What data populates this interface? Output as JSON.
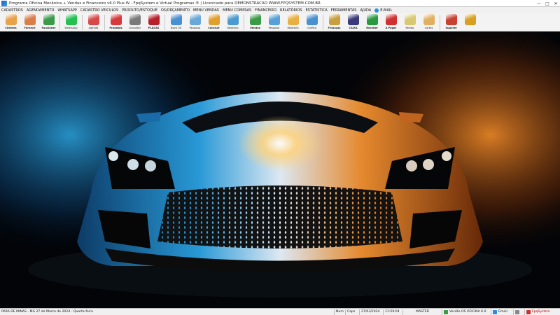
{
  "window": {
    "title": "Programa Oficina Mecânica + Vendas e Financeiro v6.0 Plus W - FpqSystem e Virtual Programas ® | Licenciado para DEMONSTRACAO WWW.FPQSYSTEM.COM.BR",
    "controls": {
      "minimize": "—",
      "maximize": "□",
      "close": "✕"
    }
  },
  "menu": [
    "CADASTROS",
    "AGENDAMENTO",
    "WHATSAPP",
    "CADASTRO VEICULOS",
    "PRODUTO/ESTOQUE",
    "OS/ORÇAMENTO",
    "MENU VENDAS",
    "MENU COMPRAS",
    "FINANCEIRO",
    "RELATÓRIOS",
    "ESTATISTICA",
    "FERRAMENTAS",
    "AJUDA",
    "E-MAIL"
  ],
  "toolbar": [
    {
      "label": "Clientes",
      "icon": "clients-icon",
      "color": "#e8a24a"
    },
    {
      "label": "Fornece",
      "icon": "supplier-icon",
      "color": "#d97d4a"
    },
    {
      "label": "Funcionar",
      "icon": "employee-icon",
      "color": "#3a9a48"
    },
    {
      "label": "WhatsApp",
      "icon": "whatsapp-icon",
      "color": "#25c050"
    },
    {
      "label": "Agenda",
      "icon": "calendar-icon",
      "color": "#d84a4a"
    },
    {
      "label": "Produtos",
      "icon": "products-icon",
      "color": "#d63a3a"
    },
    {
      "label": "Consultar",
      "icon": "scale-icon",
      "color": "#7a7a7a"
    },
    {
      "label": "PLACAS",
      "icon": "license-plate-icon",
      "color": "#b8202a"
    },
    {
      "label": "Nova OS",
      "icon": "new-order-icon",
      "color": "#4a8fd0"
    },
    {
      "label": "Pesquisa",
      "icon": "search-order-icon",
      "color": "#6aa8d8"
    },
    {
      "label": "Concluir",
      "icon": "finish-order-icon",
      "color": "#e0a030"
    },
    {
      "label": "Relatório",
      "icon": "report-icon",
      "color": "#4a9ad0"
    },
    {
      "label": "Vendas",
      "icon": "sales-icon",
      "color": "#3a9a48"
    },
    {
      "label": "Pesquisa",
      "icon": "search-sales-icon",
      "color": "#5aa0d8"
    },
    {
      "label": "Relatório",
      "icon": "sales-report-icon",
      "color": "#e8b040"
    },
    {
      "label": "Gráfico",
      "icon": "chart-icon",
      "color": "#4a8fd0"
    },
    {
      "label": "Finanças",
      "icon": "finance-icon",
      "color": "#c8a040"
    },
    {
      "label": "CAIXA",
      "icon": "cash-register-icon",
      "color": "#3a3a7a"
    },
    {
      "label": "Receber",
      "icon": "receive-icon",
      "color": "#2a9a40"
    },
    {
      "label": "A Pagar",
      "icon": "pay-icon",
      "color": "#d03030"
    },
    {
      "label": "Recibo",
      "icon": "receipt-icon",
      "color": "#d8c870"
    },
    {
      "label": "Cartas",
      "icon": "letters-icon",
      "color": "#e0b060"
    },
    {
      "label": "Suporte",
      "icon": "support-icon",
      "color": "#c84030"
    },
    {
      "label": "",
      "icon": "exit-icon",
      "color": "#d8a020"
    }
  ],
  "statusbar": {
    "location_date": "PARA DE MINAS - MG 27 de Marco de 2024 - Quarta-feira",
    "num": "Num",
    "caps": "Caps",
    "date": "27/03/2024",
    "time": "11:59:04",
    "user": "MASTER",
    "version": "Versão OS OFICINA 6.0",
    "email": "Email",
    "brand": "FpqSystem"
  }
}
